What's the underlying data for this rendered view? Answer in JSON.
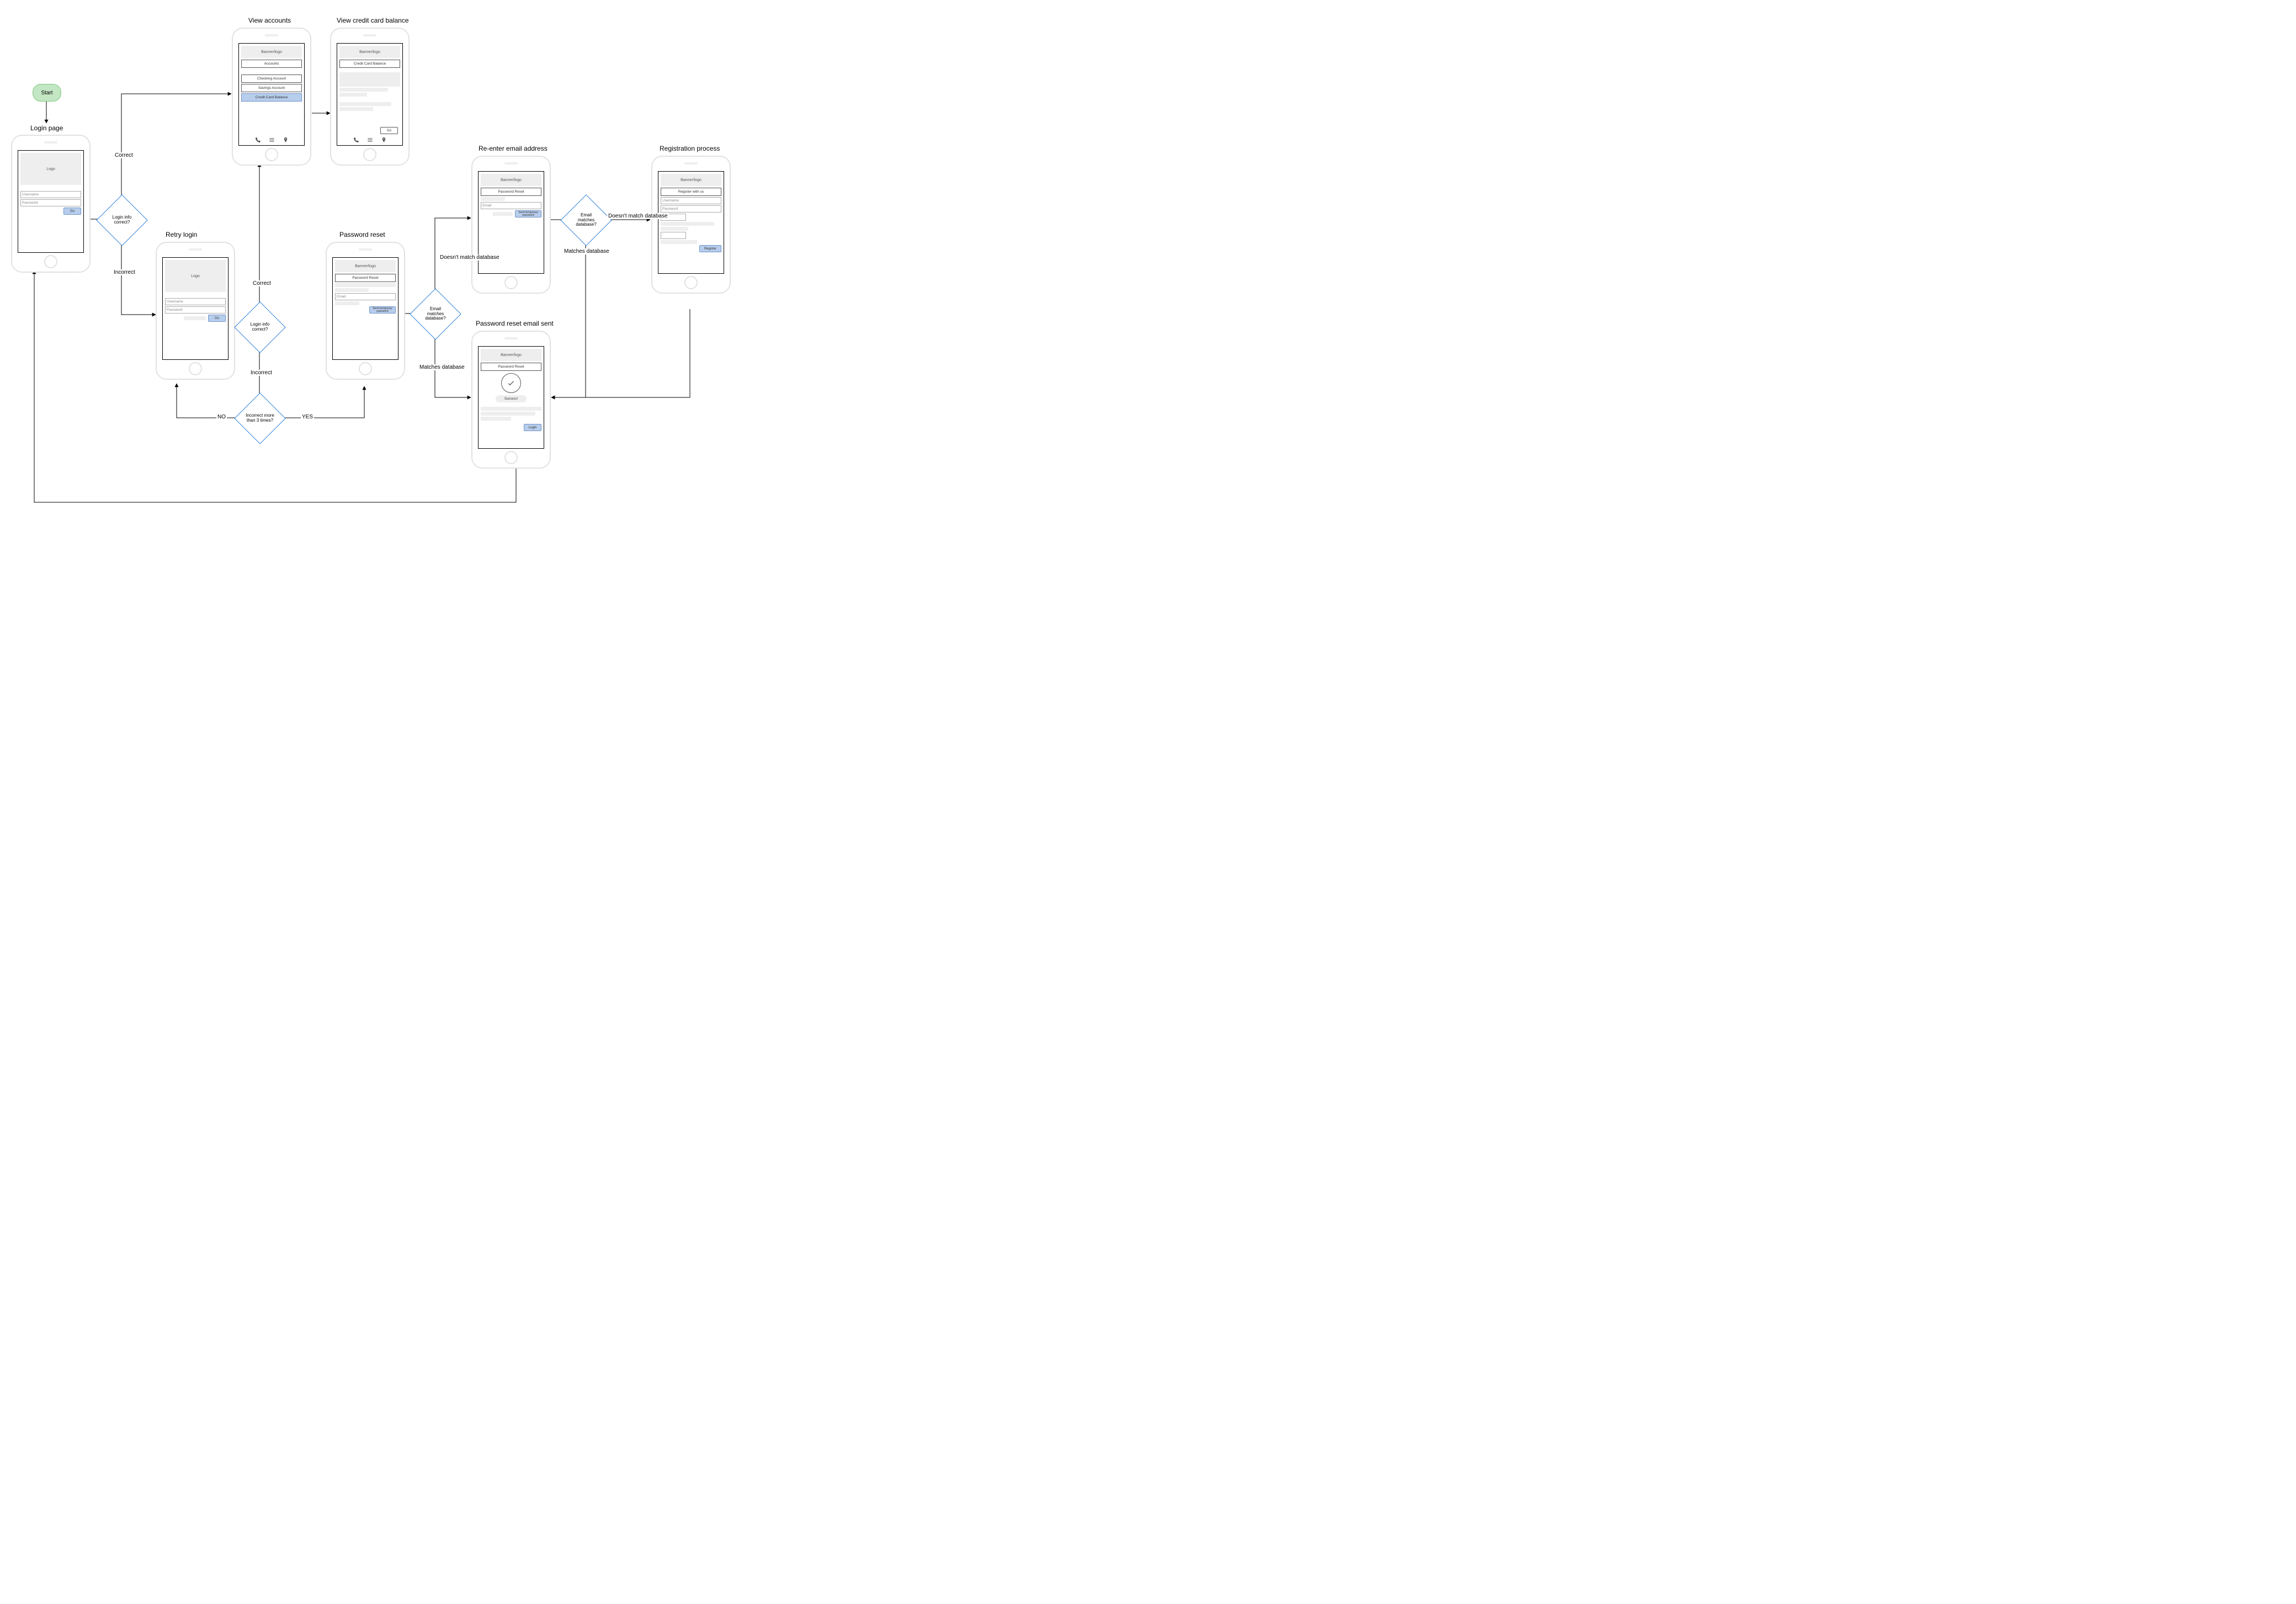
{
  "start": "Start",
  "titles": {
    "login": "Login page",
    "retry": "Retry login",
    "accounts": "View accounts",
    "cc": "View credit card balance",
    "pwreset": "Password reset",
    "reenter": "Re-enter email address",
    "pwsent": "Password reset email sent",
    "register": "Registration process"
  },
  "decisions": {
    "login1": "Login info correct?",
    "login2": "Login info correct?",
    "threetimes": "Incorrect more than 3 times?",
    "emailmatch1": "Email matches database?",
    "emailmatch2": "Email matches database?"
  },
  "edge_labels": {
    "correct": "Correct",
    "incorrect": "Incorrect",
    "yes": "YES",
    "no": "NO",
    "matches": "Matches database",
    "notmatch": "Doesn't match database",
    "notmatch2": "Doesn't match database"
  },
  "ui": {
    "banner": "Banner/logo",
    "logo": "Logo",
    "accounts": "Accounts",
    "checking": "Checking Account",
    "savings": "Savings Account",
    "ccbalance": "Credit Card Balance",
    "go": "Go",
    "login": "Login",
    "register": "Register",
    "registerTitle": "Register with us",
    "username": "Username",
    "password": "Password",
    "email": "Email",
    "pwreset": "Password Reset",
    "sendtmp": "Send temporary password",
    "success": "Success!"
  }
}
